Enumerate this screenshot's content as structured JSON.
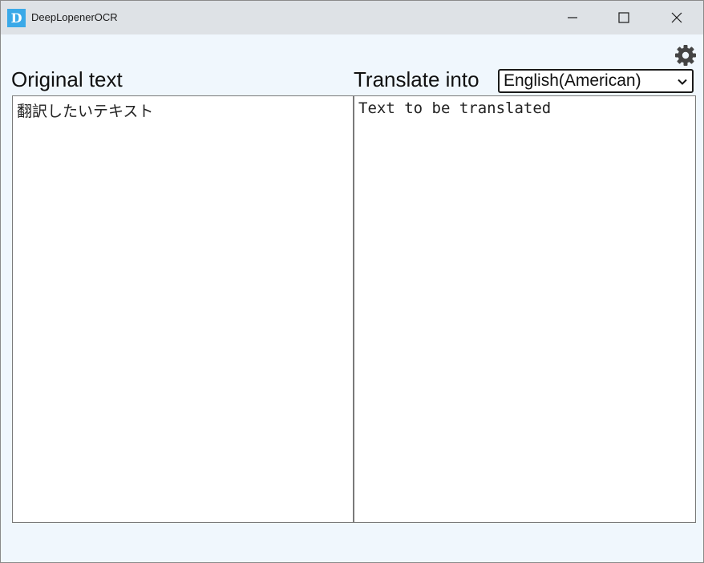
{
  "window": {
    "app_icon_letter": "D",
    "title": "DeepLopenerOCR"
  },
  "labels": {
    "original": "Original text",
    "translate_into": "Translate into"
  },
  "language_select": {
    "selected": "English(American)"
  },
  "text": {
    "original": "翻訳したいテキスト",
    "translated": "Text to be translated"
  },
  "icons": {
    "settings": "gear-icon",
    "minimize": "minimize-icon",
    "maximize": "maximize-icon",
    "close": "close-icon",
    "dropdown": "chevron-down-icon"
  },
  "colors": {
    "titlebar": "#dee2e6",
    "app_icon": "#3aa9e8",
    "client_background": "#f0f7fd",
    "gear": "#444444"
  }
}
